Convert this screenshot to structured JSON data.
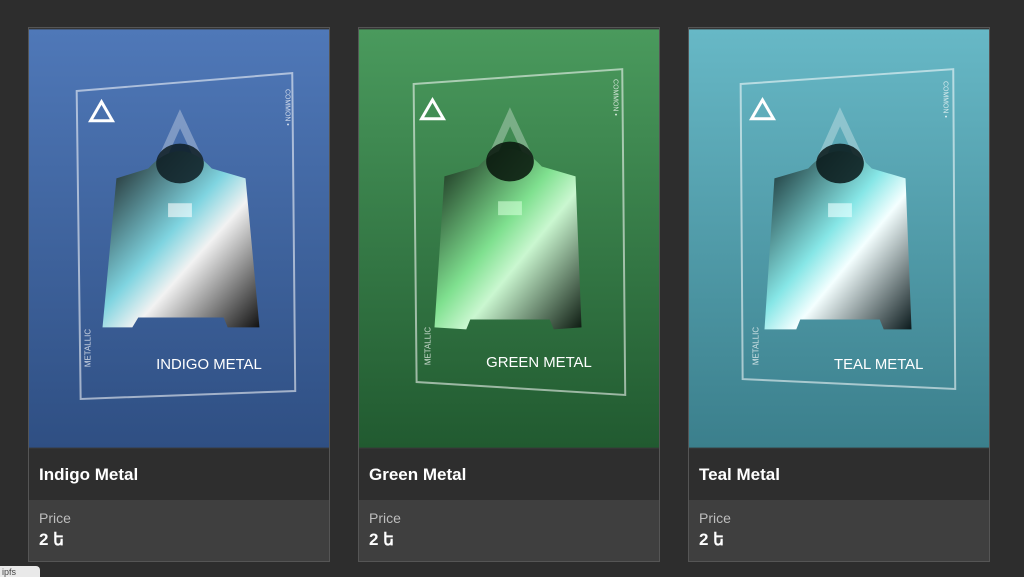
{
  "colors": {
    "page_bg": "#2d2d2d",
    "card_title_bg": "#2e2e2e",
    "card_price_bg": "#3f3f3f"
  },
  "cards": [
    {
      "title": "Indigo Metal",
      "art_caption": "INDIGO METAL",
      "art_side_left": "METALLIC",
      "art_side_right": "COMMON •",
      "price_label": "Price",
      "price_value": "2 ե",
      "bg_top": "#4f78b8",
      "bg_bottom": "#2f4f83",
      "accent": "#7fd4e0"
    },
    {
      "title": "Green Metal",
      "art_caption": "GREEN METAL",
      "art_side_left": "METALLIC",
      "art_side_right": "COMMON •",
      "price_label": "Price",
      "price_value": "2 ե",
      "bg_top": "#4a9a5d",
      "bg_bottom": "#215a30",
      "accent": "#7fe08f"
    },
    {
      "title": "Teal Metal",
      "art_caption": "TEAL METAL",
      "art_side_left": "METALLIC",
      "art_side_right": "COMMON •",
      "price_label": "Price",
      "price_value": "2 ե",
      "bg_top": "#67b8c6",
      "bg_bottom": "#3b7f8c",
      "accent": "#86e6e6"
    }
  ],
  "status_text": "ipfs"
}
